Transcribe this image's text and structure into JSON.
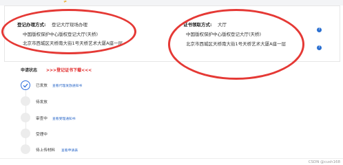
{
  "pickup_panel": {
    "left": {
      "label": "登记办理方式:",
      "value": "登记大厅现场办理",
      "line1": "中国版权保护中心版权登记大厅(天桥)",
      "line2": "北京市西城区天桥南大街1号天桥艺术大厦A座一层"
    },
    "right": {
      "label": "证书领取方式:",
      "value": "大厅",
      "line1": "中国版权保护中心版权登记大厅(天桥)",
      "line2": "北京市西城区天桥南大街1号天桥艺术大厦A座一层"
    }
  },
  "apply_status": {
    "title": "申请状态",
    "download_link": ">>>登记证书下载<<<"
  },
  "steps": [
    {
      "label": "已发放",
      "link": "查看代理发放通知书",
      "done": true
    },
    {
      "label": "待发放",
      "link": "",
      "done": false
    },
    {
      "label": "审查中",
      "link": "查看受理通知书",
      "done": false
    },
    {
      "label": "受理中",
      "link": "",
      "done": false
    },
    {
      "label": "待上传材料",
      "link": "查看申请表",
      "done": false
    }
  ],
  "watermark": "CSDN @cush168"
}
